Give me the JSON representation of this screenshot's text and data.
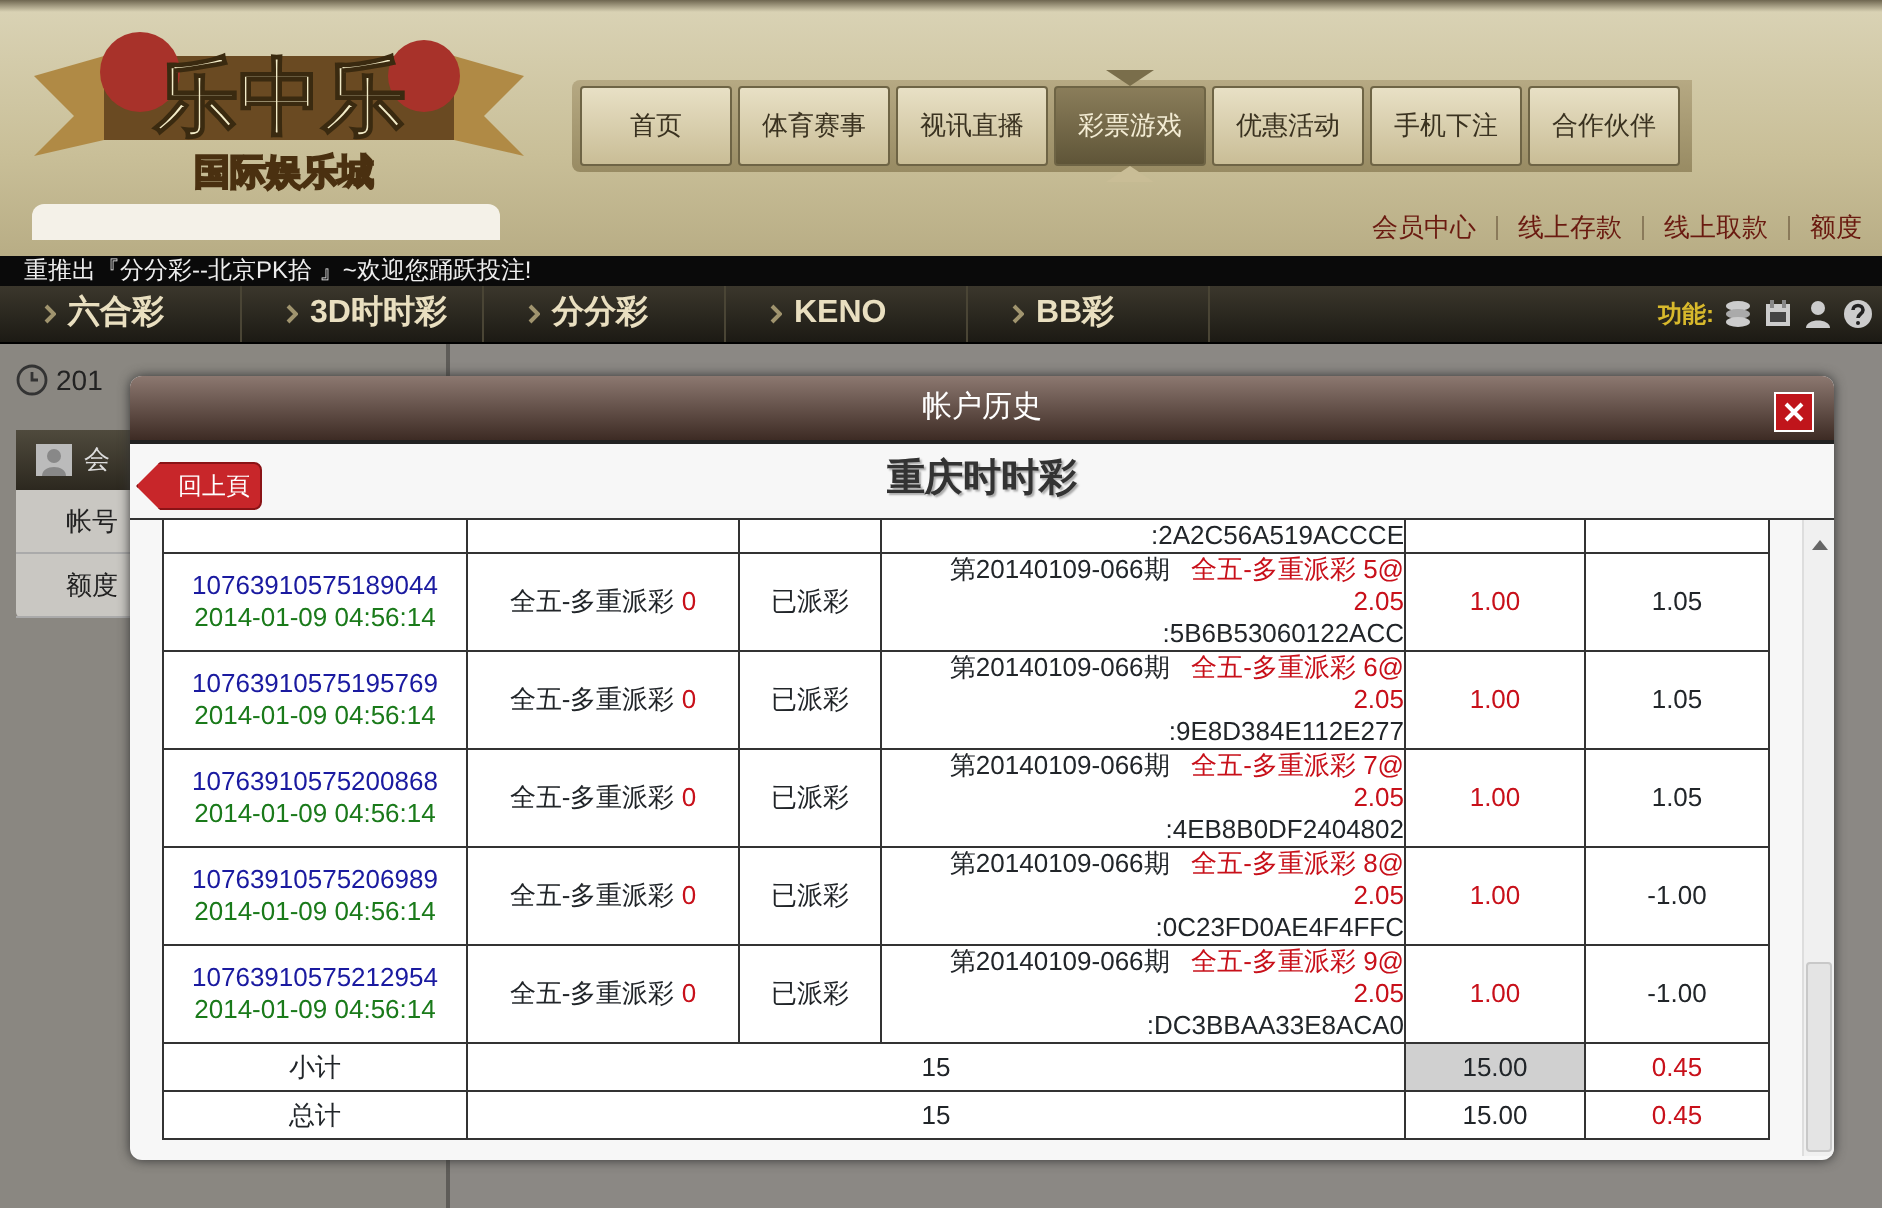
{
  "logo": {
    "title": "乐中乐",
    "subtitle": "国际娱乐城"
  },
  "main_nav": [
    {
      "label": "首页",
      "selected": false
    },
    {
      "label": "体育赛事",
      "selected": false
    },
    {
      "label": "视讯直播",
      "selected": false
    },
    {
      "label": "彩票游戏",
      "selected": true
    },
    {
      "label": "优惠活动",
      "selected": false
    },
    {
      "label": "手机下注",
      "selected": false
    },
    {
      "label": "合作伙伴",
      "selected": false
    }
  ],
  "account_links": [
    "会员中心",
    "线上存款",
    "线上取款",
    "额度"
  ],
  "ticker": "重推出『分分彩--北京PK拾 』~欢迎您踊跃投注!",
  "lottery_nav": [
    "六合彩",
    "3D时时彩",
    "分分彩",
    "KENO",
    "BB彩"
  ],
  "functions_label": "功能:",
  "clock_text": "201",
  "side_panel": {
    "header": "会",
    "rows": [
      "帐号",
      "额度"
    ]
  },
  "modal": {
    "title": "帐户历史",
    "back_button": "回上頁",
    "heading": "重庆时时彩",
    "partial_row": {
      "code": ":2A2C56A519ACCCE"
    },
    "rows": [
      {
        "id": "10763910575189044",
        "time": "2014-01-09 04:56:14",
        "bet_type": "全五-多重派彩",
        "bet_count": "0",
        "status": "已派彩",
        "period": "第20140109-066期",
        "play": "全五-多重派彩 5@",
        "odds": "2.05",
        "code": ":5B6B53060122ACC",
        "amount": "1.00",
        "result": "1.05"
      },
      {
        "id": "10763910575195769",
        "time": "2014-01-09 04:56:14",
        "bet_type": "全五-多重派彩",
        "bet_count": "0",
        "status": "已派彩",
        "period": "第20140109-066期",
        "play": "全五-多重派彩 6@",
        "odds": "2.05",
        "code": ":9E8D384E112E277",
        "amount": "1.00",
        "result": "1.05"
      },
      {
        "id": "10763910575200868",
        "time": "2014-01-09 04:56:14",
        "bet_type": "全五-多重派彩",
        "bet_count": "0",
        "status": "已派彩",
        "period": "第20140109-066期",
        "play": "全五-多重派彩 7@",
        "odds": "2.05",
        "code": ":4EB8B0DF2404802",
        "amount": "1.00",
        "result": "1.05"
      },
      {
        "id": "10763910575206989",
        "time": "2014-01-09 04:56:14",
        "bet_type": "全五-多重派彩",
        "bet_count": "0",
        "status": "已派彩",
        "period": "第20140109-066期",
        "play": "全五-多重派彩 8@",
        "odds": "2.05",
        "code": ":0C23FD0AE4F4FFC",
        "amount": "1.00",
        "result": "-1.00"
      },
      {
        "id": "10763910575212954",
        "time": "2014-01-09 04:56:14",
        "bet_type": "全五-多重派彩",
        "bet_count": "0",
        "status": "已派彩",
        "period": "第20140109-066期",
        "play": "全五-多重派彩 9@",
        "odds": "2.05",
        "code": ":DC3BBAA33E8ACA0",
        "amount": "1.00",
        "result": "-1.00"
      }
    ],
    "totals": [
      {
        "label": "小计",
        "count": "15",
        "amount": "15.00",
        "result": "0.45",
        "highlighted": true
      },
      {
        "label": "总计",
        "count": "15",
        "amount": "15.00",
        "result": "0.45",
        "highlighted": false
      }
    ]
  }
}
